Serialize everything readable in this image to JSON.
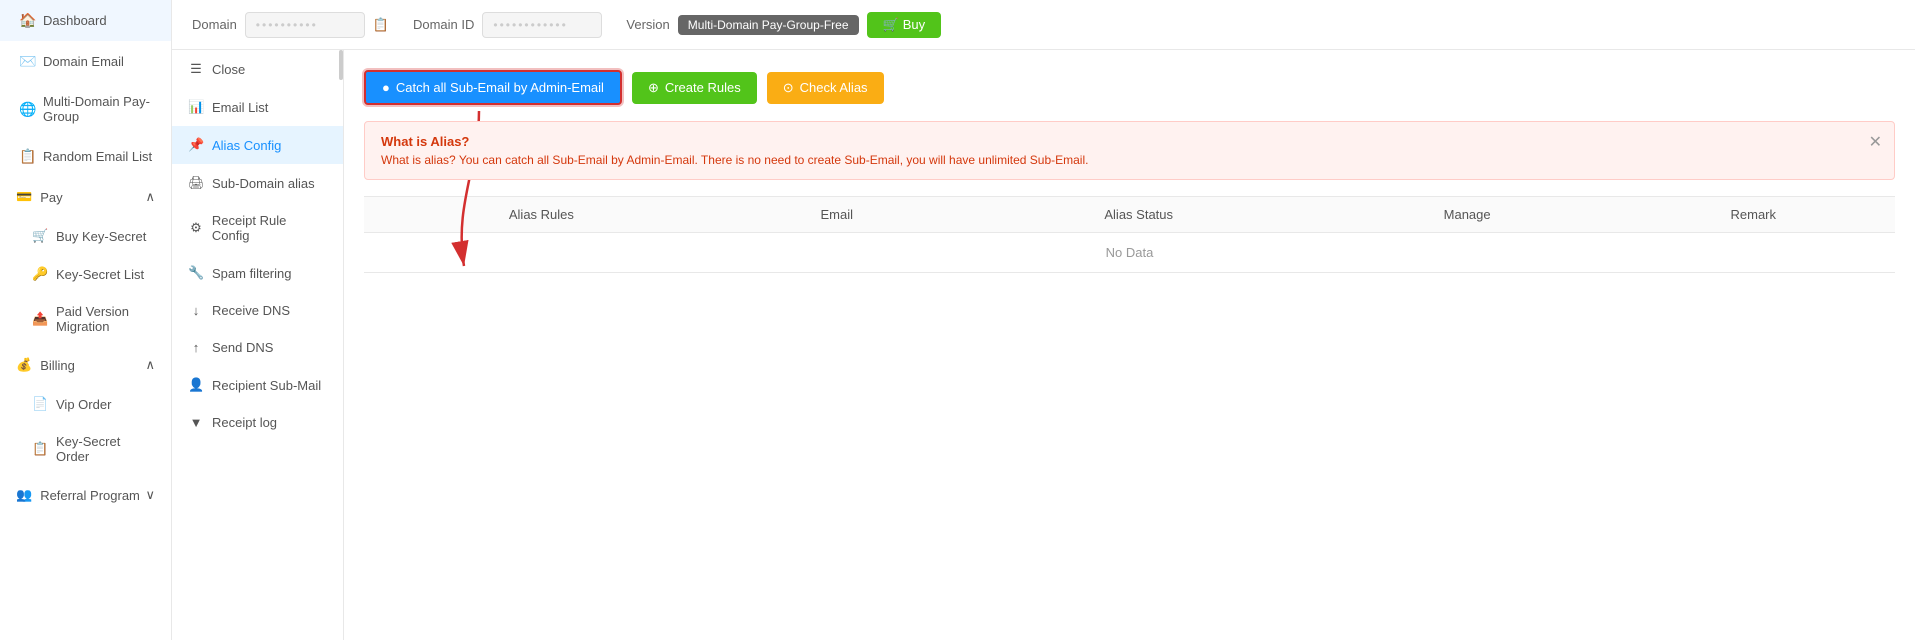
{
  "sidebar": {
    "items": [
      {
        "id": "dashboard",
        "label": "Dashboard",
        "icon": "🏠"
      },
      {
        "id": "domain-email",
        "label": "Domain Email",
        "icon": "✉️"
      },
      {
        "id": "multi-domain",
        "label": "Multi-Domain Pay-Group",
        "icon": "🌐"
      },
      {
        "id": "random-email",
        "label": "Random Email List",
        "icon": "📋"
      },
      {
        "id": "pay",
        "label": "Pay",
        "icon": "💳",
        "expandable": true,
        "expanded": true
      },
      {
        "id": "buy-key-secret",
        "label": "Buy Key-Secret",
        "icon": "🛒",
        "sub": true
      },
      {
        "id": "key-secret-list",
        "label": "Key-Secret List",
        "icon": "🔑",
        "sub": true
      },
      {
        "id": "paid-version",
        "label": "Paid Version Migration",
        "icon": "📤",
        "sub": true
      },
      {
        "id": "billing",
        "label": "Billing",
        "icon": "💰",
        "expandable": true,
        "expanded": true
      },
      {
        "id": "vip-order",
        "label": "Vip Order",
        "icon": "📄",
        "sub": true
      },
      {
        "id": "key-secret-order",
        "label": "Key-Secret Order",
        "icon": "📋",
        "sub": true
      },
      {
        "id": "referral",
        "label": "Referral Program",
        "icon": "👥",
        "expandable": true,
        "expanded": false
      }
    ]
  },
  "topbar": {
    "domain_label": "Domain",
    "domain_id_label": "Domain ID",
    "version_label": "Version",
    "version_value": "Multi-Domain Pay-Group-Free",
    "buy_label": "Buy",
    "domain_placeholder": "••••••••••",
    "domain_id_placeholder": "••••••••••••"
  },
  "sub_sidebar": {
    "items": [
      {
        "id": "close",
        "label": "Close",
        "icon": "☰"
      },
      {
        "id": "email-list",
        "label": "Email List",
        "icon": "📊"
      },
      {
        "id": "alias-config",
        "label": "Alias Config",
        "icon": "📌",
        "active": true
      },
      {
        "id": "sub-domain-alias",
        "label": "Sub-Domain alias",
        "icon": "🖨"
      },
      {
        "id": "receipt-rule-config",
        "label": "Receipt Rule Config",
        "icon": "🔘"
      },
      {
        "id": "spam-filtering",
        "label": "Spam filtering",
        "icon": "🔧"
      },
      {
        "id": "receive-dns",
        "label": "Receive DNS",
        "icon": "↓"
      },
      {
        "id": "send-dns",
        "label": "Send DNS",
        "icon": "↑"
      },
      {
        "id": "recipient-sub-mail",
        "label": "Recipient Sub-Mail",
        "icon": "👤"
      },
      {
        "id": "receipt-log",
        "label": "Receipt log",
        "icon": "▼"
      }
    ]
  },
  "action_bar": {
    "catch_label": "Catch all Sub-Email by Admin-Email",
    "create_label": "Create Rules",
    "check_label": "Check Alias"
  },
  "info_banner": {
    "title": "What is Alias?",
    "text": "What is alias? You can catch all Sub-Email by Admin-Email. There is no need to create Sub-Email, you will have unlimited Sub-Email."
  },
  "table": {
    "columns": [
      "Alias Rules",
      "Email",
      "Alias Status",
      "Manage",
      "Remark"
    ],
    "no_data": "No Data"
  }
}
